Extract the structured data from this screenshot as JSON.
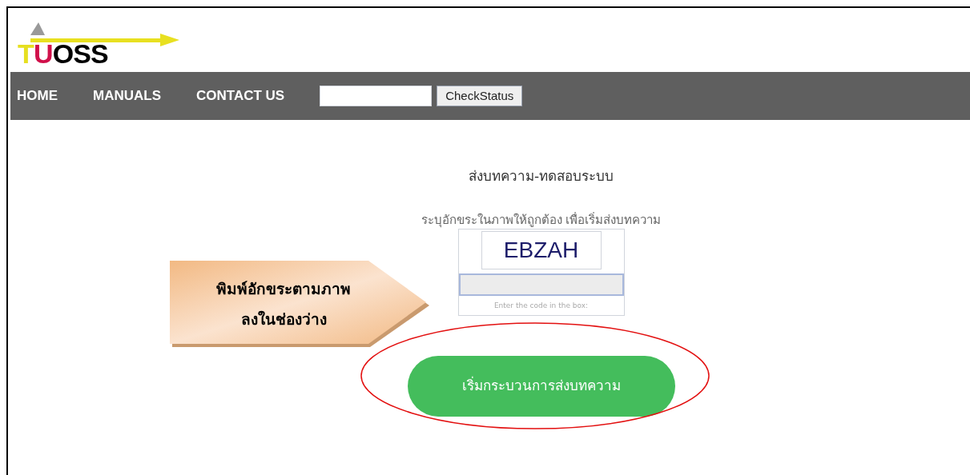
{
  "logo": {
    "text": "TUOSS"
  },
  "nav": {
    "items": [
      "HOME",
      "MANUALS",
      "CONTACT US"
    ],
    "status_button": "CheckStatus"
  },
  "main": {
    "title": "ส่งบทความ-ทดสอบระบบ",
    "instruction": "ระบุอักขระในภาพให้ถูกต้อง เพื่อเริ่มส่งบทความ",
    "captcha_code": "EBZAH",
    "captcha_hint": "Enter the code in the box:",
    "start_button": "เริ่มกระบวนการส่งบทความ"
  },
  "callout": {
    "lines": [
      "พิมพ์อักขระตามภาพ",
      "ลงในช่องว่าง"
    ]
  }
}
